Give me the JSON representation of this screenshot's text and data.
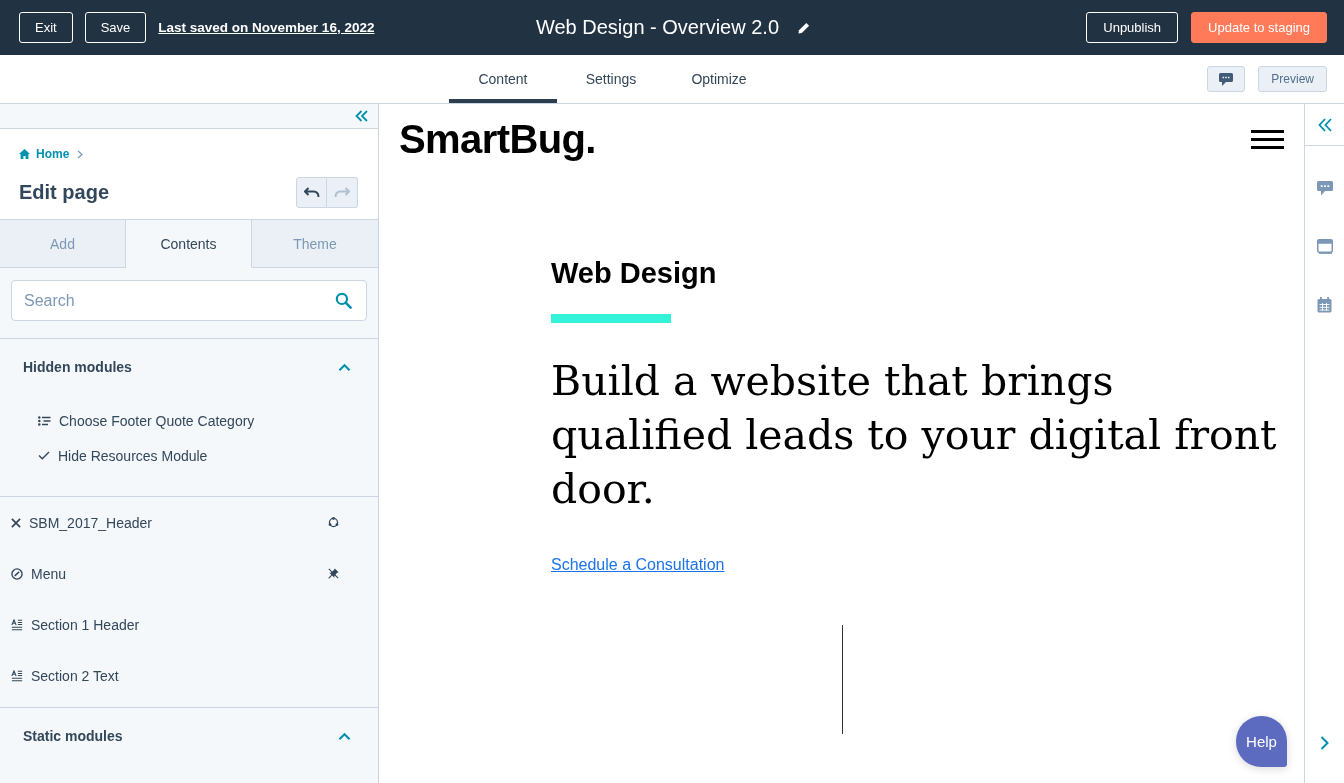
{
  "top_bar": {
    "buttons": [
      {
        "label": "Exit"
      },
      {
        "label": "Save"
      }
    ],
    "last_saved": "Last saved on November 16, 2022",
    "title": "Web Design - Overview 2.0",
    "actions": [
      {
        "label": "Unpublish",
        "kind": "outline"
      },
      {
        "label": "Update to staging",
        "kind": "primary"
      }
    ]
  },
  "editor_tabs": [
    {
      "label": "Content",
      "selected": true
    },
    {
      "label": "Settings",
      "selected": false
    },
    {
      "label": "Optimize",
      "selected": false
    }
  ],
  "preview_button": "Preview",
  "sidebar": {
    "breadcrumb": "Home",
    "heading": "Edit page",
    "history": [
      {
        "kind": "undo",
        "disabled": false
      },
      {
        "kind": "redo",
        "disabled": true
      }
    ],
    "tabs": [
      {
        "label": "Add",
        "selected": false
      },
      {
        "label": "Contents",
        "selected": true
      },
      {
        "label": "Theme",
        "selected": false
      }
    ],
    "search": {
      "placeholder": "Search"
    },
    "hidden_modules": {
      "title": "Hidden modules",
      "expanded": true,
      "items": [
        {
          "label": "Choose Footer Quote Category",
          "kind": "choice"
        },
        {
          "label": "Hide Resources Module",
          "kind": "boolean"
        }
      ]
    },
    "modules": [
      {
        "label": "SBM_2017_Header",
        "kind": "global",
        "synced": true,
        "unpinned": false
      },
      {
        "label": "Menu",
        "kind": "menu",
        "synced": false,
        "unpinned": true
      },
      {
        "label": "Section 1 Header",
        "kind": "rich_text",
        "synced": false,
        "unpinned": false
      },
      {
        "label": "Section 2 Text",
        "kind": "rich_text",
        "synced": false,
        "unpinned": false
      }
    ],
    "static_modules": {
      "title": "Static modules",
      "expanded": true
    }
  },
  "preview": {
    "logo": "SmartBug.",
    "eyebrow": "Web Design",
    "headline": "Build a website that brings qualified leads to your digital front door.",
    "link": "Schedule a Consultation"
  },
  "help_button": "Help"
}
